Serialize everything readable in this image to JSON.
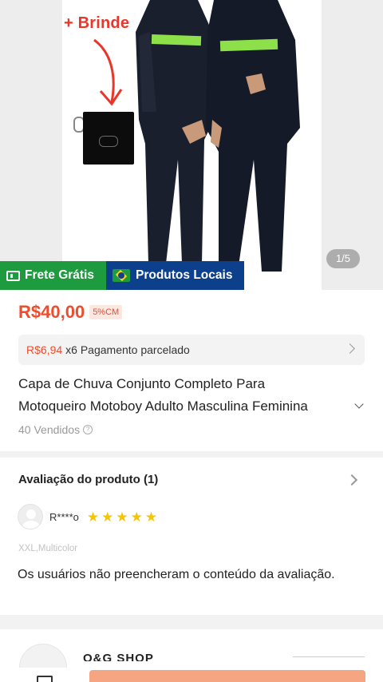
{
  "gallery": {
    "promo_label": "+ Brinde",
    "image_counter": "1/5",
    "tags": {
      "free_shipping": "Frete Grátis",
      "local_products": "Produtos Locais"
    }
  },
  "product": {
    "price": "R$40,00",
    "cashback_badge": "5%CM",
    "installment": {
      "amount": "R$6,94",
      "text": "x6 Pagamento parcelado"
    },
    "title_line1": "Capa de Chuva Conjunto Completo Para",
    "title_line2": "Motoqueiro Motoboy Adulto Masculina Feminina",
    "sold": "40 Vendidos"
  },
  "reviews": {
    "heading": "Avaliação do produto (1)",
    "items": [
      {
        "user": "R****o",
        "rating": 5,
        "variant": "XXL,Multicolor",
        "text": "Os usuários não preencheram o conteúdo da avaliação."
      }
    ]
  },
  "shop": {
    "name": "O&G SHOP"
  },
  "colors": {
    "accent": "#ee4d2d",
    "free_shipping_bg": "#1e9b3f",
    "local_bg": "#0c3f8c",
    "star": "#f7c400",
    "buy_button": "#f6a582"
  },
  "icons": {
    "free_shipping": "truck-icon",
    "local_products": "brazil-flag-icon",
    "installment_chevron": "chevron-right-icon",
    "title_expand": "chevron-down-icon",
    "sold_info": "info-icon",
    "review_chevron": "chevron-right-icon",
    "star": "star-icon",
    "bottom_chat": "chat-icon"
  }
}
